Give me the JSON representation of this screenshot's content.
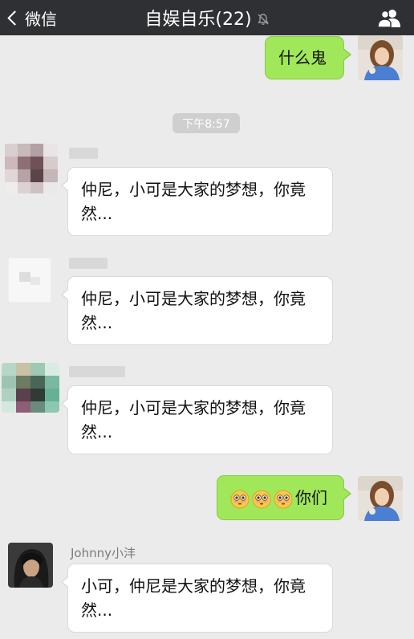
{
  "header": {
    "back_label": "微信",
    "title": "自娱自乐(22)"
  },
  "messages": [
    {
      "side": "right",
      "text": "什么鬼"
    },
    {
      "side": "time",
      "text": "下午8:57"
    },
    {
      "side": "left",
      "sender": "",
      "text": "仲尼，小可是大家的梦想，你竟然..."
    },
    {
      "side": "left",
      "sender": "",
      "text": "仲尼，小可是大家的梦想，你竟然..."
    },
    {
      "side": "left",
      "sender": "",
      "text": "仲尼，小可是大家的梦想，你竟然..."
    },
    {
      "side": "right",
      "emoji_count": 3,
      "emoji_name": "flushed-face-emoji",
      "text": "你们"
    },
    {
      "side": "left",
      "sender": "Johnny小沣",
      "text": "小可，仲尼是大家的梦想，你竟然..."
    }
  ],
  "colors": {
    "header_bg": "#2f3033",
    "chat_bg": "#ebebeb",
    "outgoing_bubble": "#a0e75a",
    "incoming_bubble": "#ffffff",
    "time_badge": "#cfcfcf"
  }
}
